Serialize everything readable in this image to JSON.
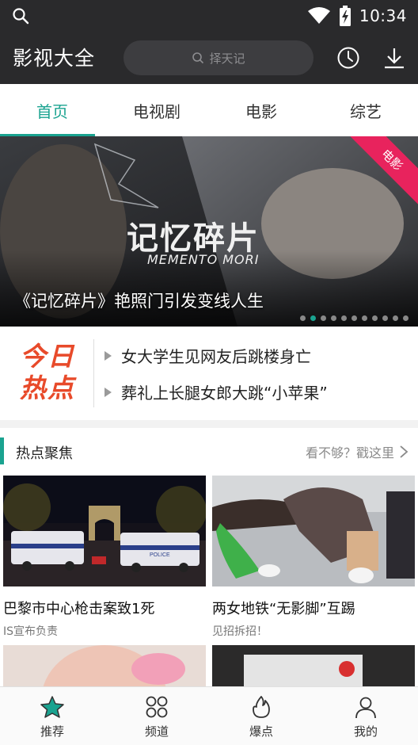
{
  "status_bar": {
    "time": "10:34"
  },
  "header": {
    "app_title": "影视大全",
    "search_placeholder": "择天记"
  },
  "tabs": [
    {
      "label": "首页",
      "active": true
    },
    {
      "label": "电视剧",
      "active": false
    },
    {
      "label": "电影",
      "active": false
    },
    {
      "label": "综艺",
      "active": false
    }
  ],
  "banner": {
    "caption": "《记忆碎片》艳照门引发变线人生",
    "poster_title": "记忆碎片",
    "poster_subtitle": "MEMENTO MORI",
    "ribbon": "电影",
    "dots_count": 11,
    "active_dot": 1
  },
  "hot_news": {
    "logo_line1": "今日",
    "logo_line2": "热点",
    "items": [
      "女大学生见网友后跳楼身亡",
      "葬礼上长腿女郎大跳“小苹果”"
    ]
  },
  "section": {
    "title": "热点聚焦",
    "more": "看不够？戳这里"
  },
  "cards": [
    {
      "title": "巴黎市中心枪击案致1死",
      "subtitle": "IS宣布负责",
      "police_text": "POLICE"
    },
    {
      "title": "两女地铁“无影脚”互踢",
      "subtitle": "见招拆招！"
    }
  ],
  "bottom_nav": [
    {
      "label": "推荐",
      "icon": "star-icon"
    },
    {
      "label": "频道",
      "icon": "channels-icon"
    },
    {
      "label": "爆点",
      "icon": "flame-icon"
    },
    {
      "label": "我的",
      "icon": "user-icon"
    }
  ],
  "colors": {
    "accent": "#1aa390",
    "ribbon": "#e8235d",
    "hot_logo": "#e84a2a",
    "topbar": "#2a2a2c"
  }
}
